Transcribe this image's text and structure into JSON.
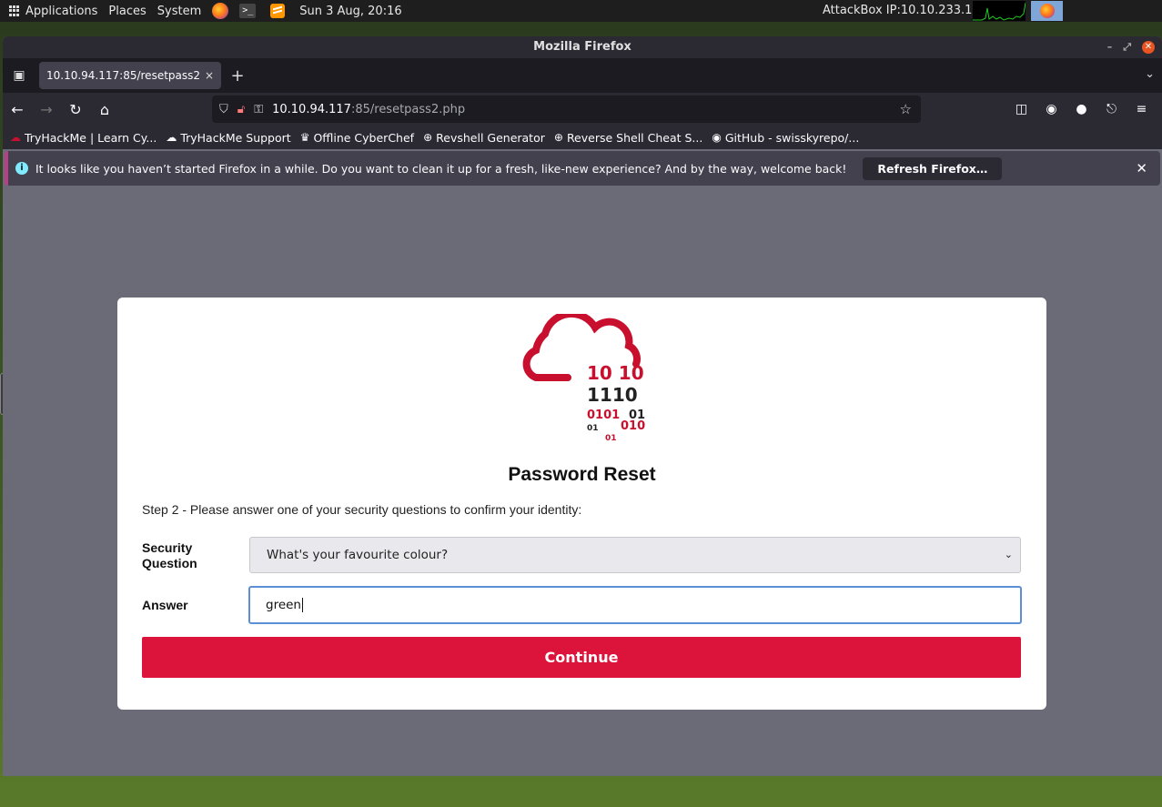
{
  "top_panel": {
    "applications": "Applications",
    "places": "Places",
    "system": "System",
    "clock": "Sun 3 Aug, 20:16",
    "attackbox": "AttackBox IP:10.10.233.108"
  },
  "window": {
    "title": "Mozilla Firefox"
  },
  "tab": {
    "title": "10.10.94.117:85/resetpass2.",
    "close": "×"
  },
  "urlbar": {
    "host": "10.10.94.117",
    "rest": ":85/resetpass2.php"
  },
  "bookmarks": [
    {
      "label": "TryHackMe | Learn Cy...",
      "icon": "thm-icon"
    },
    {
      "label": "TryHackMe Support",
      "icon": "support-icon"
    },
    {
      "label": "Offline CyberChef",
      "icon": "chef-icon"
    },
    {
      "label": "Revshell Generator",
      "icon": "globe-icon"
    },
    {
      "label": "Reverse Shell Cheat S...",
      "icon": "globe-icon"
    },
    {
      "label": "GitHub - swisskyrepo/...",
      "icon": "github-icon"
    }
  ],
  "infobar": {
    "message": "It looks like you haven’t started Firefox in a while. Do you want to clean it up for a fresh, like-new experience? And by the way, welcome back!",
    "button": "Refresh Firefox…"
  },
  "logo": {
    "row1": "10 10",
    "row2": "1110",
    "row3a": "0101",
    "row3b": "01",
    "row4a": "01",
    "row4b": "010",
    "row5": "01"
  },
  "form": {
    "title": "Password Reset",
    "step": "Step 2 - Please answer one of your security questions to confirm your identity:",
    "security_label_line1": "Security",
    "security_label_line2": "Question",
    "selected_question": "What's your favourite colour?",
    "answer_label": "Answer",
    "answer_value": "green",
    "submit": "Continue"
  },
  "colors": {
    "accent": "#dc143c",
    "logo_red": "#c8102e",
    "focus_border": "#5b8fd6"
  }
}
